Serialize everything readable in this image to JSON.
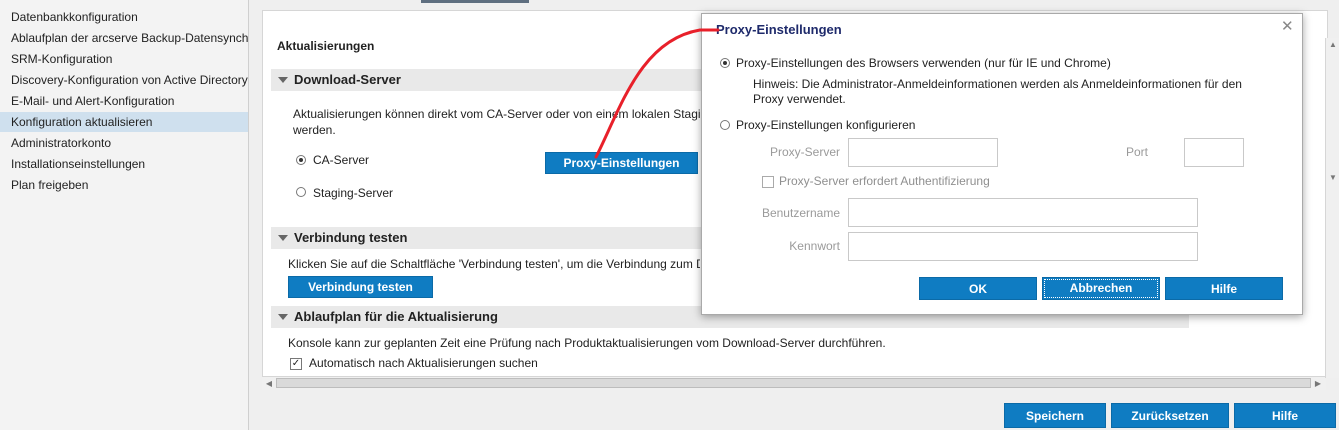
{
  "sidebar": {
    "items": [
      {
        "label": "Datenbankkonfiguration"
      },
      {
        "label": "Ablaufplan der arcserve Backup-Datensynchronisierung"
      },
      {
        "label": "SRM-Konfiguration"
      },
      {
        "label": "Discovery-Konfiguration von Active Directory"
      },
      {
        "label": "E-Mail- und Alert-Konfiguration"
      },
      {
        "label": "Konfiguration aktualisieren"
      },
      {
        "label": "Administratorkonto"
      },
      {
        "label": "Installationseinstellungen"
      },
      {
        "label": "Plan freigeben"
      }
    ],
    "active_index": 5
  },
  "main": {
    "title": "Aktualisierungen",
    "download": {
      "header": "Download-Server",
      "description_line1": "Aktualisierungen können direkt vom CA-Server oder von einem lokalen Staging-Server heruntergeladen",
      "description_line2": "werden.",
      "radio_ca": "CA-Server",
      "radio_staging": "Staging-Server",
      "proxy_button": "Proxy-Einstellungen"
    },
    "test": {
      "header": "Verbindung testen",
      "description": "Klicken Sie auf die Schaltfläche 'Verbindung testen', um die Verbindung zum Download-Server zu testen.",
      "button": "Verbindung testen"
    },
    "schedule": {
      "header": "Ablaufplan für die Aktualisierung",
      "description": "Konsole kann zur geplanten Zeit eine Prüfung nach Produktaktualisierungen vom Download-Server durchführen.",
      "checkbox_label": "Automatisch nach Aktualisierungen suchen",
      "checkbox_checked": true
    }
  },
  "footer": {
    "save": "Speichern",
    "reset": "Zurücksetzen",
    "help": "Hilfe"
  },
  "dialog": {
    "title": "Proxy-Einstellungen",
    "option_browser": "Proxy-Einstellungen des Browsers verwenden (nur für IE und Chrome)",
    "hint_line1": "Hinweis: Die Administrator-Anmeldeinformationen werden als Anmeldeinformationen für den",
    "hint_line2": "Proxy verwendet.",
    "option_configure": "Proxy-Einstellungen konfigurieren",
    "proxy_server_label": "Proxy-Server",
    "port_label": "Port",
    "auth_label": "Proxy-Server erfordert Authentifizierung",
    "username_label": "Benutzername",
    "password_label": "Kennwort",
    "ok": "OK",
    "cancel": "Abbrechen",
    "help": "Hilfe"
  },
  "colors": {
    "accent_button": "#0f7cc2",
    "annotation": "#e8202a",
    "dialog_title": "#1e2a6b"
  }
}
